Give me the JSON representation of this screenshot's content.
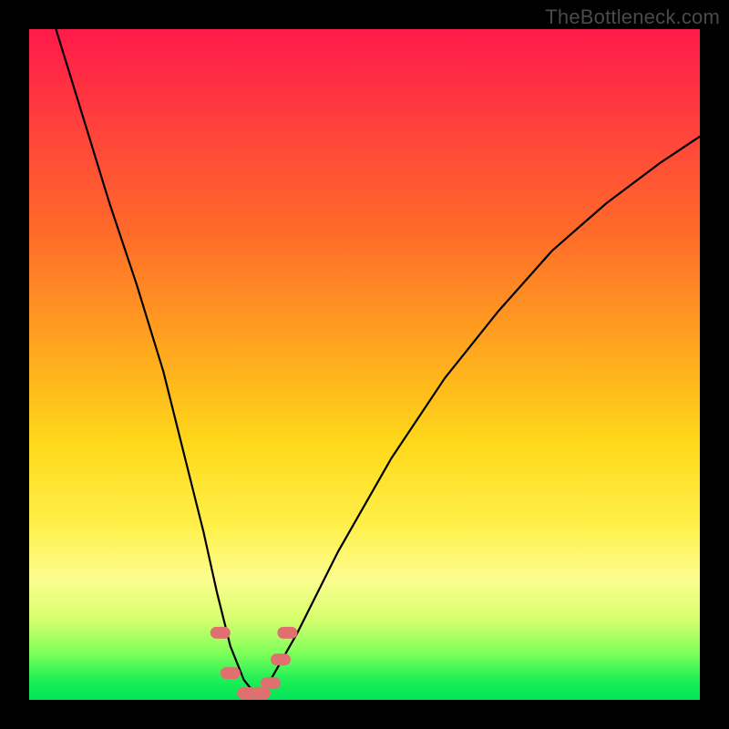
{
  "watermark": "TheBottleneck.com",
  "colors": {
    "background": "#000000",
    "curve_stroke": "#000000",
    "marker_fill": "#e07070",
    "gradient_top": "#ff1a4b",
    "gradient_bottom": "#00e558"
  },
  "chart_data": {
    "type": "line",
    "title": "",
    "xlabel": "",
    "ylabel": "",
    "xlim": [
      0,
      100
    ],
    "ylim": [
      0,
      100
    ],
    "series": [
      {
        "name": "bottleneck-curve",
        "x": [
          4,
          8,
          12,
          16,
          20,
          23,
          26,
          28,
          30,
          32,
          34,
          36,
          40,
          46,
          54,
          62,
          70,
          78,
          86,
          94,
          100
        ],
        "values": [
          100,
          87,
          74,
          62,
          49,
          37,
          25,
          16,
          8,
          3,
          0.5,
          3,
          10,
          22,
          36,
          48,
          58,
          67,
          74,
          80,
          84
        ]
      }
    ],
    "markers": {
      "name": "highlighted-points",
      "x": [
        28.5,
        30,
        32.5,
        34.5,
        36,
        37.5,
        38.5
      ],
      "values": [
        10,
        4,
        1,
        1,
        2.5,
        6,
        10
      ]
    }
  }
}
